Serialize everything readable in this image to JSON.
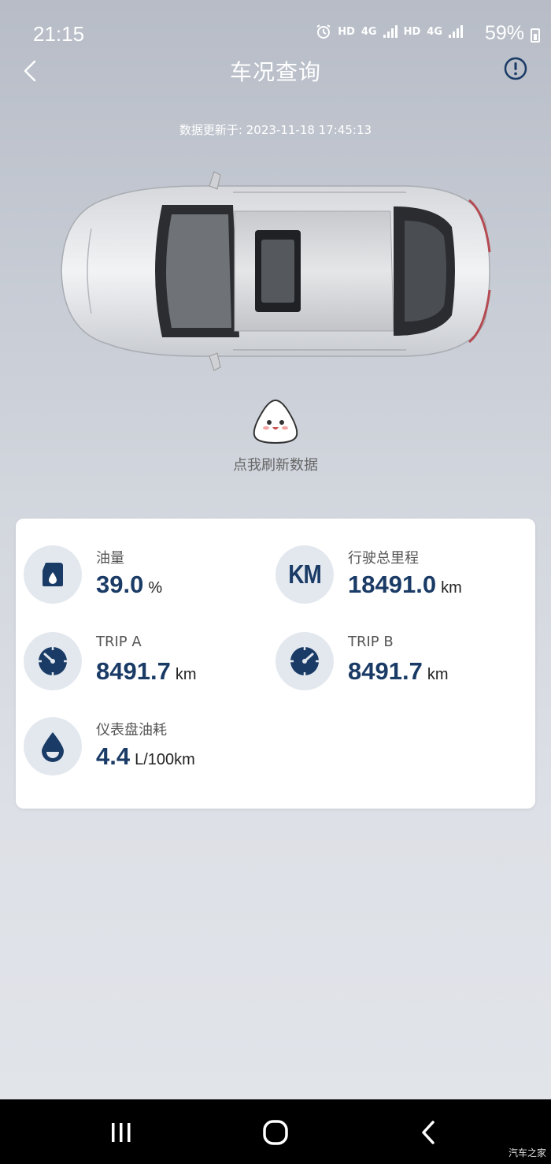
{
  "status_bar": {
    "time": "21:15",
    "net_labels": [
      "HD",
      "4G",
      "HD",
      "4G"
    ],
    "battery": "59%"
  },
  "nav": {
    "title": "车况查询"
  },
  "update_time": "数据更新于: 2023-11-18 17:45:13",
  "refresh": {
    "label": "点我刷新数据"
  },
  "stats": {
    "fuel": {
      "label": "油量",
      "value": "39.0",
      "unit": "%"
    },
    "odometer": {
      "label": "行驶总里程",
      "value": "18491.0",
      "unit": "km",
      "icon_text": "KM"
    },
    "trip_a": {
      "label": "TRIP A",
      "value": "8491.7",
      "unit": "km"
    },
    "trip_b": {
      "label": "TRIP B",
      "value": "8491.7",
      "unit": "km"
    },
    "consumption": {
      "label": "仪表盘油耗",
      "value": "4.4",
      "unit": "L/100km"
    }
  },
  "watermark": "汽车之家",
  "colors": {
    "accent": "#1a3b66",
    "icon_bg": "#e3e8ef"
  }
}
